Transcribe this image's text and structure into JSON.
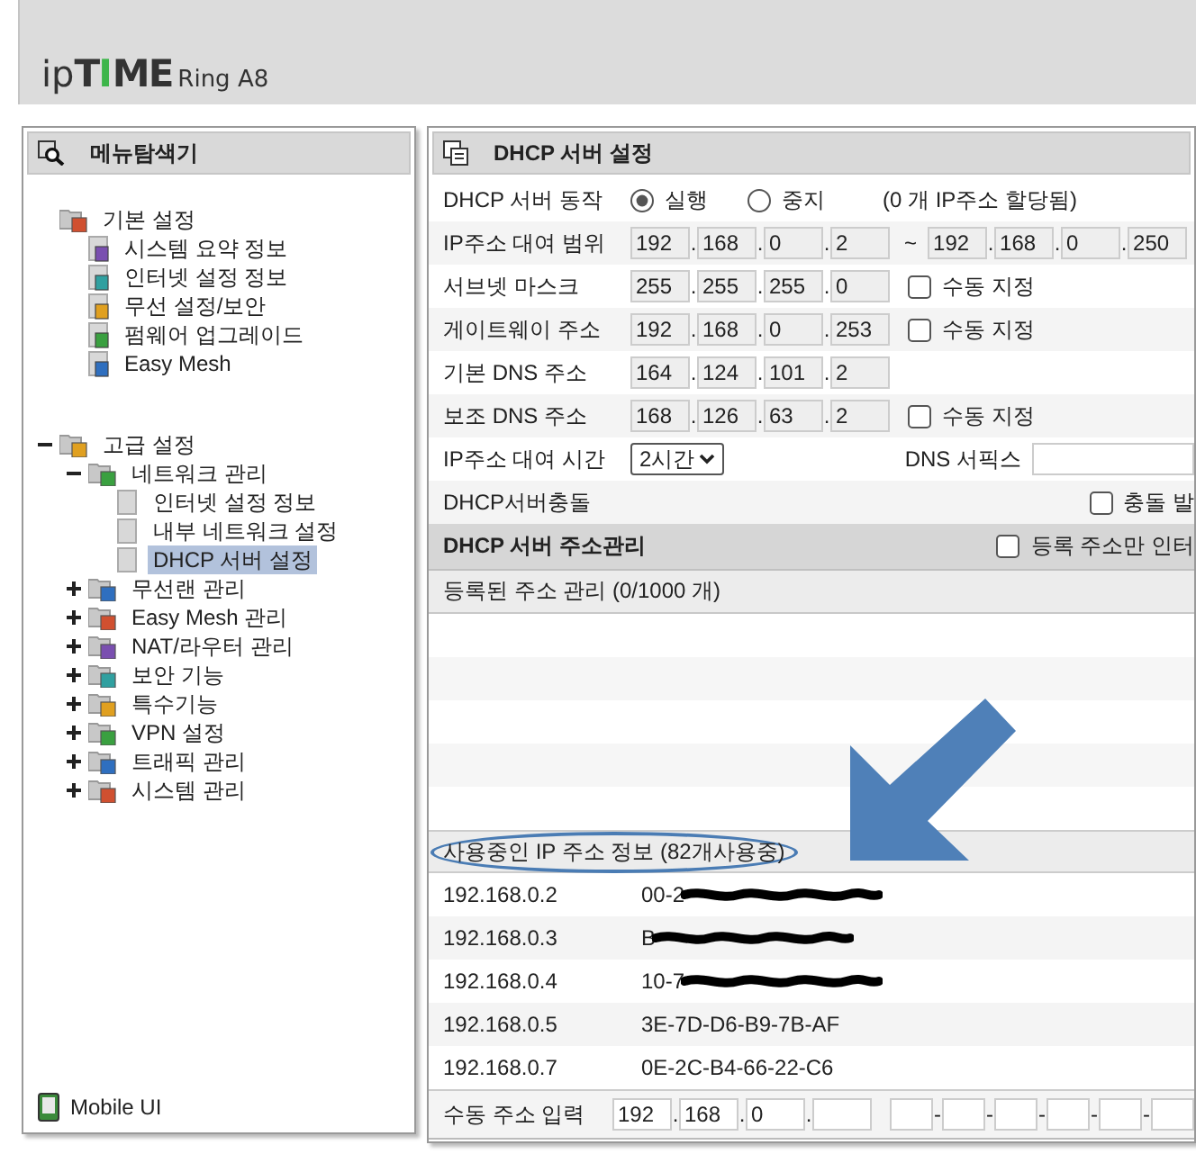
{
  "header": {
    "logo": [
      {
        "text": "ip",
        "kind": "light"
      },
      {
        "text": "T",
        "kind": "bold"
      },
      {
        "text": "I",
        "kind": "accent"
      },
      {
        "text": "ME",
        "kind": "bold"
      }
    ],
    "model": "Ring A8"
  },
  "menu": {
    "title": "메뉴탐색기",
    "groups": [
      {
        "label": "기본 설정",
        "children": [
          {
            "label": "시스템 요약 정보",
            "selected": false
          },
          {
            "label": "인터넷 설정 정보",
            "selected": false
          },
          {
            "label": "무선 설정/보안",
            "selected": false
          },
          {
            "label": "펌웨어 업그레이드",
            "selected": false
          },
          {
            "label": "Easy Mesh",
            "selected": false
          }
        ]
      },
      {
        "label": "고급 설정",
        "expanded": true,
        "children": [
          {
            "label": "네트워크 관리",
            "expanded": true,
            "children": [
              {
                "label": "인터넷 설정 정보",
                "selected": false
              },
              {
                "label": "내부 네트워크 설정",
                "selected": false
              },
              {
                "label": "DHCP 서버 설정",
                "selected": true
              }
            ]
          },
          {
            "label": "무선랜 관리",
            "expanded": false
          },
          {
            "label": "Easy Mesh 관리",
            "expanded": false
          },
          {
            "label": "NAT/라우터 관리",
            "expanded": false
          },
          {
            "label": "보안 기능",
            "expanded": false
          },
          {
            "label": "특수기능",
            "expanded": false
          },
          {
            "label": "VPN 설정",
            "expanded": false
          },
          {
            "label": "트래픽 관리",
            "expanded": false
          },
          {
            "label": "시스템 관리",
            "expanded": false
          }
        ]
      }
    ],
    "footer": "Mobile UI"
  },
  "dhcp": {
    "title": "DHCP 서버 설정",
    "separator": ".",
    "rows": [
      {
        "kind": "radio",
        "label": "DHCP 서버 동작",
        "options": [
          {
            "label": "실행",
            "selected": true
          },
          {
            "label": "중지",
            "selected": false
          }
        ],
        "note": "(0 개 IP주소 할당됨)"
      },
      {
        "kind": "range",
        "label": "IP주소 대여 범위",
        "start": [
          "192",
          "168",
          "0",
          "2"
        ],
        "to": "~",
        "end": [
          "192",
          "168",
          "0",
          "250"
        ]
      },
      {
        "kind": "ip",
        "label": "서브넷 마스크",
        "octets": [
          "255",
          "255",
          "255",
          "0"
        ],
        "option": {
          "label": "수동 지정",
          "checked": false
        }
      },
      {
        "kind": "ip",
        "label": "게이트웨이 주소",
        "octets": [
          "192",
          "168",
          "0",
          "253"
        ],
        "option": {
          "label": "수동 지정",
          "checked": false
        }
      },
      {
        "kind": "ip",
        "label": "기본 DNS 주소",
        "octets": [
          "164",
          "124",
          "101",
          "2"
        ]
      },
      {
        "kind": "ip",
        "label": "보조 DNS 주소",
        "octets": [
          "168",
          "126",
          "63",
          "2"
        ],
        "option": {
          "label": "수동 지정",
          "checked": false
        }
      },
      {
        "kind": "lease",
        "label": "IP주소 대여 시간",
        "value": "2시간",
        "suffix_label": "DNS 서픽스"
      },
      {
        "kind": "check",
        "label": "DHCP서버충돌",
        "option": {
          "label": "충돌 발",
          "checked": false
        }
      }
    ]
  },
  "manage": {
    "title": "DHCP 서버 주소관리",
    "option": {
      "label": "등록 주소만 인터",
      "checked": false
    },
    "registered": "등록된 주소 관리 (0/1000 개)"
  },
  "in_use": {
    "title": "사용중인 IP 주소 정보 (82개사용중)",
    "circled": true,
    "rows": [
      {
        "ip": "192.168.0.2",
        "mac": "00-2",
        "redacted": true
      },
      {
        "ip": "192.168.0.3",
        "mac": "B",
        "redacted": true
      },
      {
        "ip": "192.168.0.4",
        "mac": "10-7",
        "redacted": true
      },
      {
        "ip": "192.168.0.5",
        "mac": "3E-7D-D6-B9-7B-AF",
        "redacted": false
      },
      {
        "ip": "192.168.0.7",
        "mac": "0E-2C-B4-66-22-C6",
        "redacted": false
      }
    ]
  },
  "manual": {
    "label": "수동 주소 입력",
    "mac_separator": "-",
    "ip_fields": [
      {
        "value": "192"
      },
      {
        "value": "168"
      },
      {
        "value": "0"
      },
      {
        "kind": "empty"
      }
    ],
    "mac_fields": [
      {
        "kind": "empty"
      },
      {
        "kind": "empty"
      },
      {
        "kind": "empty"
      },
      {
        "kind": "empty"
      },
      {
        "kind": "empty"
      },
      {
        "kind": "empty"
      }
    ]
  }
}
